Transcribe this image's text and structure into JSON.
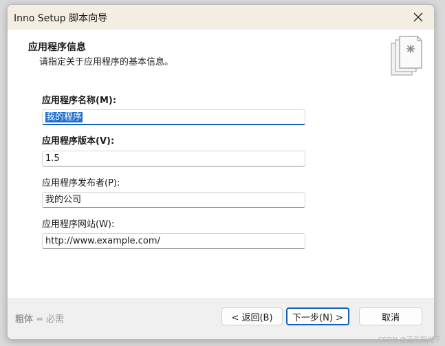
{
  "window": {
    "title": "Inno Setup 脚本向导"
  },
  "header": {
    "title": "应用程序信息",
    "subtitle": "请指定关于应用程序的基本信息。"
  },
  "fields": [
    {
      "label": "应用程序名称(M):",
      "value": "我的程序",
      "required": true
    },
    {
      "label": "应用程序版本(V):",
      "value": "1.5",
      "required": true
    },
    {
      "label": "应用程序发布者(P):",
      "value": "我的公司",
      "required": false
    },
    {
      "label": "应用程序网站(W):",
      "value": "http://www.example.com/",
      "required": false
    }
  ],
  "footer": {
    "required_bold": "粗体",
    "required_rest": " = 必需",
    "back_label": "< 返回(B)",
    "next_label": "下一步(N) >",
    "cancel_label": "取消"
  },
  "watermark": "CSDN @正午阳光下",
  "icons": {
    "close": "close-icon",
    "wizard": "document-wizard-icon"
  },
  "colors": {
    "accent": "#1560b8",
    "selection": "#1f6fd0",
    "titlebar": "#f3ede2"
  }
}
